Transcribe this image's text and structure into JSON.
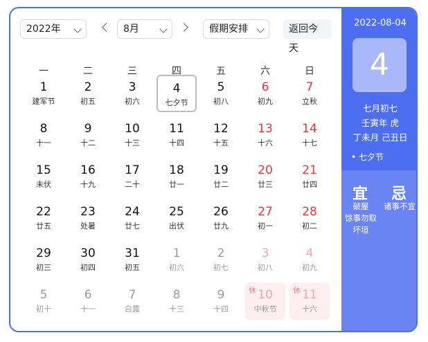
{
  "toolbar": {
    "year": "2022年",
    "month": "8月",
    "holiday_select": "假期安排",
    "today_label": "返回今天"
  },
  "weekdays": [
    "一",
    "二",
    "三",
    "四",
    "五",
    "六",
    "日"
  ],
  "days": [
    {
      "num": "1",
      "lunar": "建军节",
      "weekend": false,
      "other": false
    },
    {
      "num": "2",
      "lunar": "初五",
      "weekend": false,
      "other": false
    },
    {
      "num": "3",
      "lunar": "初六",
      "weekend": false,
      "other": false
    },
    {
      "num": "4",
      "lunar": "七夕节",
      "weekend": false,
      "other": false,
      "selected": true
    },
    {
      "num": "5",
      "lunar": "初八",
      "weekend": false,
      "other": false
    },
    {
      "num": "6",
      "lunar": "初九",
      "weekend": true,
      "other": false
    },
    {
      "num": "7",
      "lunar": "立秋",
      "weekend": true,
      "other": false
    },
    {
      "num": "8",
      "lunar": "十一",
      "weekend": false,
      "other": false
    },
    {
      "num": "9",
      "lunar": "十二",
      "weekend": false,
      "other": false
    },
    {
      "num": "10",
      "lunar": "十三",
      "weekend": false,
      "other": false
    },
    {
      "num": "11",
      "lunar": "十四",
      "weekend": false,
      "other": false
    },
    {
      "num": "12",
      "lunar": "十五",
      "weekend": false,
      "other": false
    },
    {
      "num": "13",
      "lunar": "十六",
      "weekend": true,
      "other": false
    },
    {
      "num": "14",
      "lunar": "十七",
      "weekend": true,
      "other": false
    },
    {
      "num": "15",
      "lunar": "末伏",
      "weekend": false,
      "other": false
    },
    {
      "num": "16",
      "lunar": "十九",
      "weekend": false,
      "other": false
    },
    {
      "num": "17",
      "lunar": "二十",
      "weekend": false,
      "other": false
    },
    {
      "num": "18",
      "lunar": "廿一",
      "weekend": false,
      "other": false
    },
    {
      "num": "19",
      "lunar": "廿二",
      "weekend": false,
      "other": false
    },
    {
      "num": "20",
      "lunar": "廿三",
      "weekend": true,
      "other": false
    },
    {
      "num": "21",
      "lunar": "廿四",
      "weekend": true,
      "other": false
    },
    {
      "num": "22",
      "lunar": "廿五",
      "weekend": false,
      "other": false
    },
    {
      "num": "23",
      "lunar": "处暑",
      "weekend": false,
      "other": false
    },
    {
      "num": "24",
      "lunar": "廿七",
      "weekend": false,
      "other": false
    },
    {
      "num": "25",
      "lunar": "出伏",
      "weekend": false,
      "other": false
    },
    {
      "num": "26",
      "lunar": "廿九",
      "weekend": false,
      "other": false
    },
    {
      "num": "27",
      "lunar": "初一",
      "weekend": true,
      "other": false
    },
    {
      "num": "28",
      "lunar": "初二",
      "weekend": true,
      "other": false
    },
    {
      "num": "29",
      "lunar": "初三",
      "weekend": false,
      "other": false
    },
    {
      "num": "30",
      "lunar": "初四",
      "weekend": false,
      "other": false
    },
    {
      "num": "31",
      "lunar": "初五",
      "weekend": false,
      "other": false
    },
    {
      "num": "1",
      "lunar": "初六",
      "weekend": false,
      "other": true
    },
    {
      "num": "2",
      "lunar": "初七",
      "weekend": false,
      "other": true
    },
    {
      "num": "3",
      "lunar": "初八",
      "weekend": true,
      "other": true
    },
    {
      "num": "4",
      "lunar": "初九",
      "weekend": true,
      "other": true
    },
    {
      "num": "5",
      "lunar": "初十",
      "weekend": false,
      "other": true
    },
    {
      "num": "6",
      "lunar": "十一",
      "weekend": false,
      "other": true
    },
    {
      "num": "7",
      "lunar": "白露",
      "weekend": false,
      "other": true
    },
    {
      "num": "8",
      "lunar": "十三",
      "weekend": false,
      "other": true
    },
    {
      "num": "9",
      "lunar": "十四",
      "weekend": false,
      "other": true
    },
    {
      "num": "10",
      "lunar": "中秋节",
      "weekend": true,
      "other": true,
      "holiday": true,
      "rest": "休"
    },
    {
      "num": "11",
      "lunar": "十六",
      "weekend": true,
      "other": true,
      "holiday": true,
      "rest": "休"
    }
  ],
  "side": {
    "date": "2022-08-04",
    "big_day": "4",
    "lunar_date": "七月初七",
    "ganzhi_year": "壬寅年 虎",
    "ganzhi_month_day": "丁未月 己丑日",
    "festival": "• 七夕节",
    "yi_title": "宜",
    "ji_title": "忌",
    "yi_lines": [
      "破屋",
      "馀事勿取",
      "坏垣"
    ],
    "ji_lines": [
      "诸事不宜"
    ]
  },
  "colors": {
    "accent": "#4e6ef2",
    "weekend": "#f0313a",
    "holiday_bg": "#fdeff0"
  }
}
